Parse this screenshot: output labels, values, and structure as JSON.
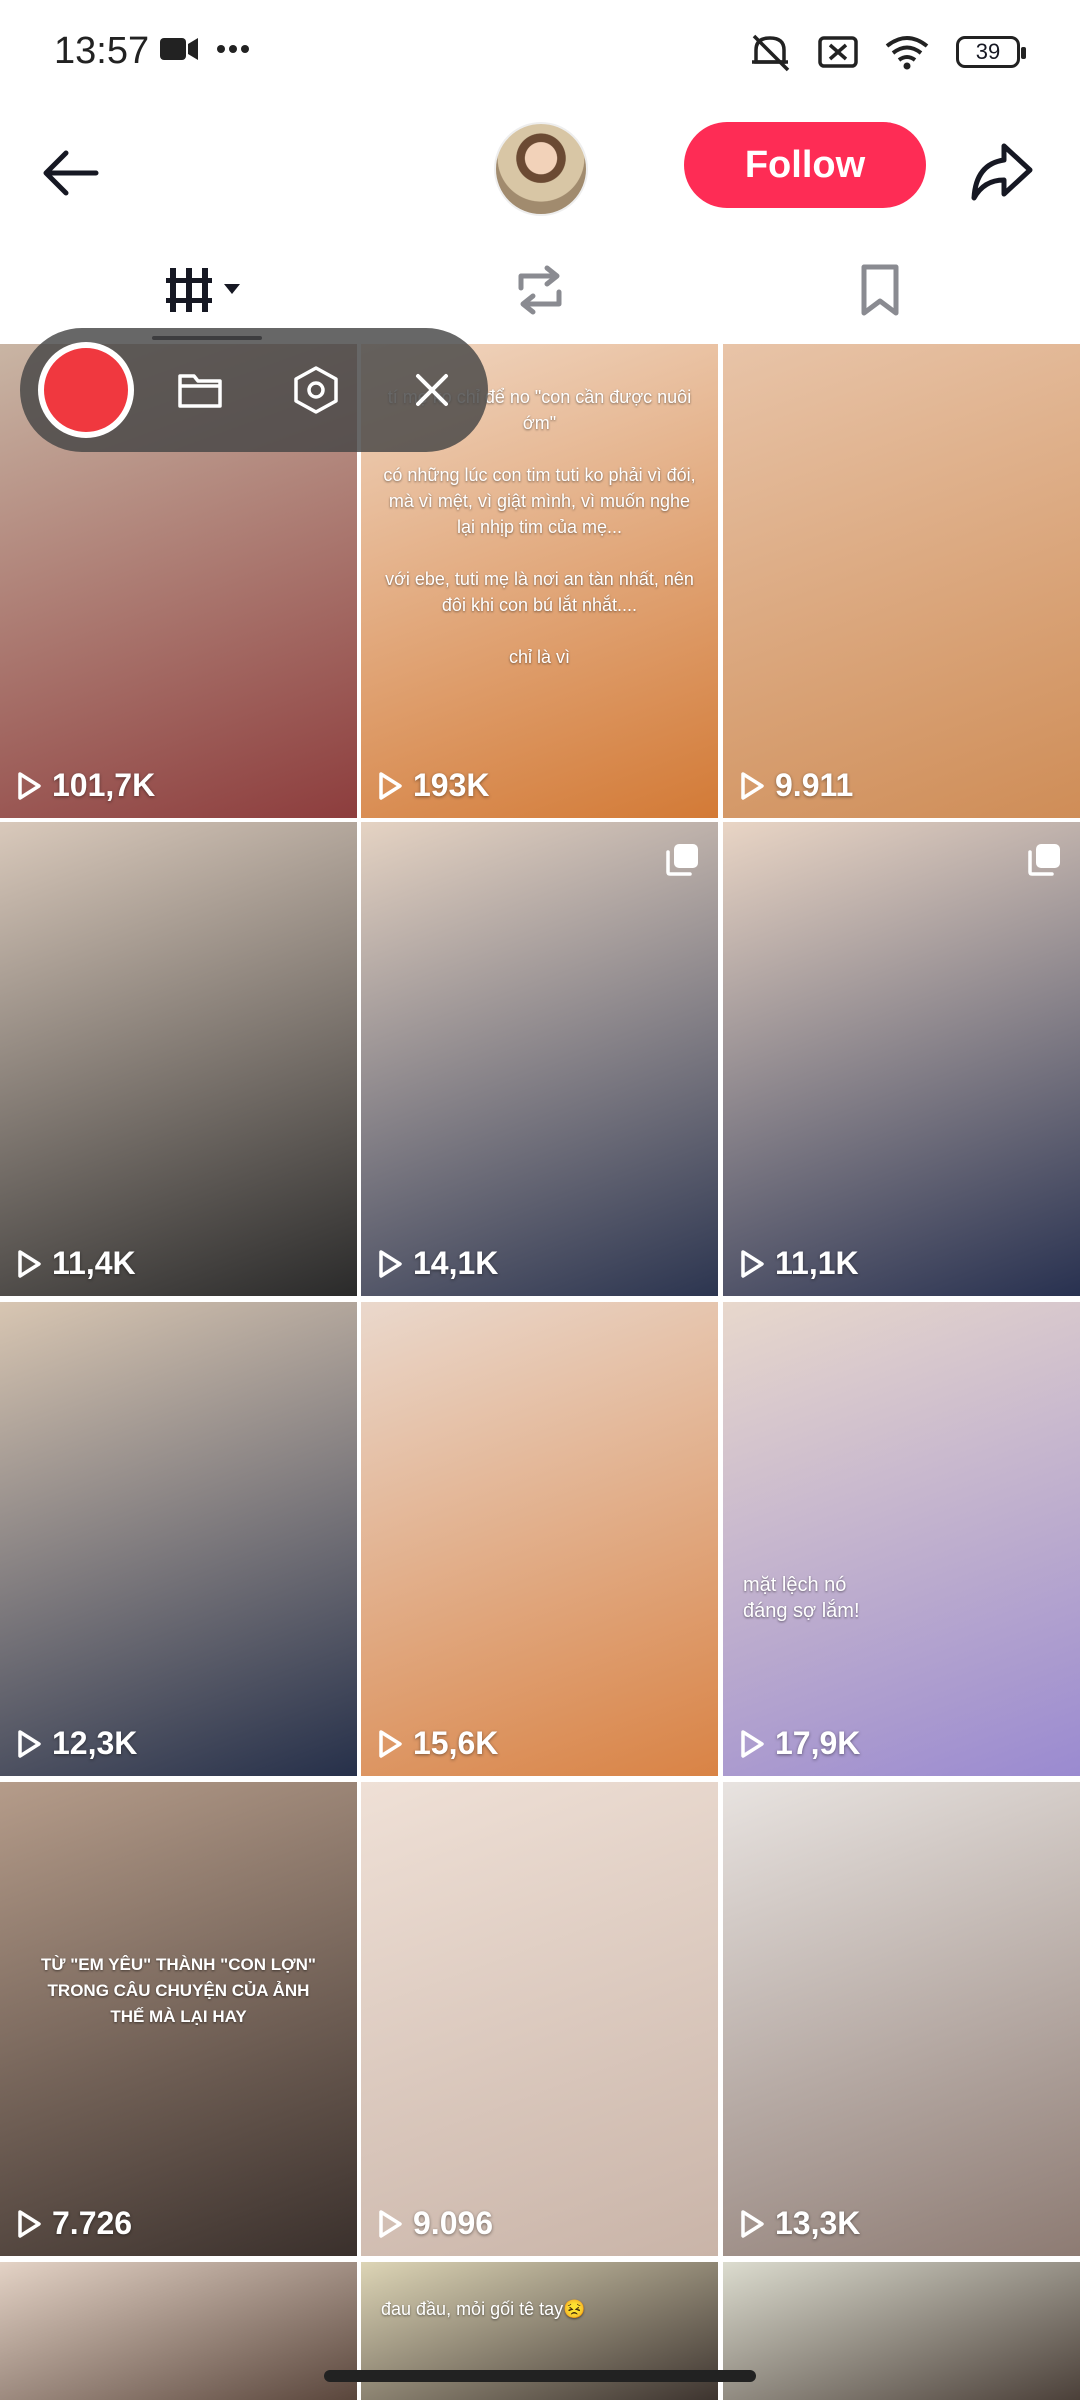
{
  "status_bar": {
    "time": "13:57",
    "battery": "39"
  },
  "header": {
    "follow_label": "Follow"
  },
  "grid": {
    "items": [
      {
        "views": "101,7K",
        "colors": [
          "#c9b5a4",
          "#8d3d3d"
        ]
      },
      {
        "views": "193K",
        "colors": [
          "#f0d6c1",
          "#d37a36"
        ],
        "text": "tí mẹ ko chỉ để no \"con cần được nuôi ớm\"\n\ncó những lúc con tim tuti ko phải vì đói, mà vì mệt, vì giật mình, vì muốn nghe lại nhịp tim của mẹ...\n\nvới ebe, tuti mẹ là nơi an tàn nhất, nên đôi khi con bú lắt nhắt....\n\nchỉ là vì"
      },
      {
        "views": "9.911",
        "colors": [
          "#e8c4a8",
          "#cf8d57"
        ]
      },
      {
        "views": "11,4K",
        "colors": [
          "#d9c9bb",
          "#2a2a2a"
        ]
      },
      {
        "views": "14,1K",
        "colors": [
          "#e5d3c3",
          "#2c3550"
        ],
        "multi": true
      },
      {
        "views": "11,1K",
        "colors": [
          "#e9d5c5",
          "#283150"
        ],
        "multi": true
      },
      {
        "views": "12,3K",
        "colors": [
          "#d8c6b2",
          "#26304a"
        ]
      },
      {
        "views": "15,6K",
        "colors": [
          "#ead8cc",
          "#d98345"
        ]
      },
      {
        "views": "17,9K",
        "colors": [
          "#e8d8cc",
          "#9a8ad0"
        ],
        "text": "mặt lệch nó\nđáng sợ lắm!"
      },
      {
        "views": "7.726",
        "colors": [
          "#b59c8a",
          "#3a302c"
        ],
        "text": "TỪ \"EM YÊU\" THÀNH \"CON LỢN\"\nTRONG CÂU CHUYỆN CỦA ẢNH\nTHẾ MÀ LẠI HAY"
      },
      {
        "views": "9.096",
        "colors": [
          "#efe0d6",
          "#c9b4a8"
        ]
      },
      {
        "views": "13,3K",
        "colors": [
          "#e8e3e0",
          "#8d7b73"
        ]
      },
      {
        "views": "",
        "colors": [
          "#e4d3c6",
          "#5a463c"
        ]
      },
      {
        "views": "",
        "colors": [
          "#ddd5b6",
          "#3d342f"
        ],
        "text": "đau đầu, mỏi gối tê tay😣"
      },
      {
        "views": "",
        "colors": [
          "#dcdccf",
          "#4b4039"
        ]
      }
    ]
  }
}
